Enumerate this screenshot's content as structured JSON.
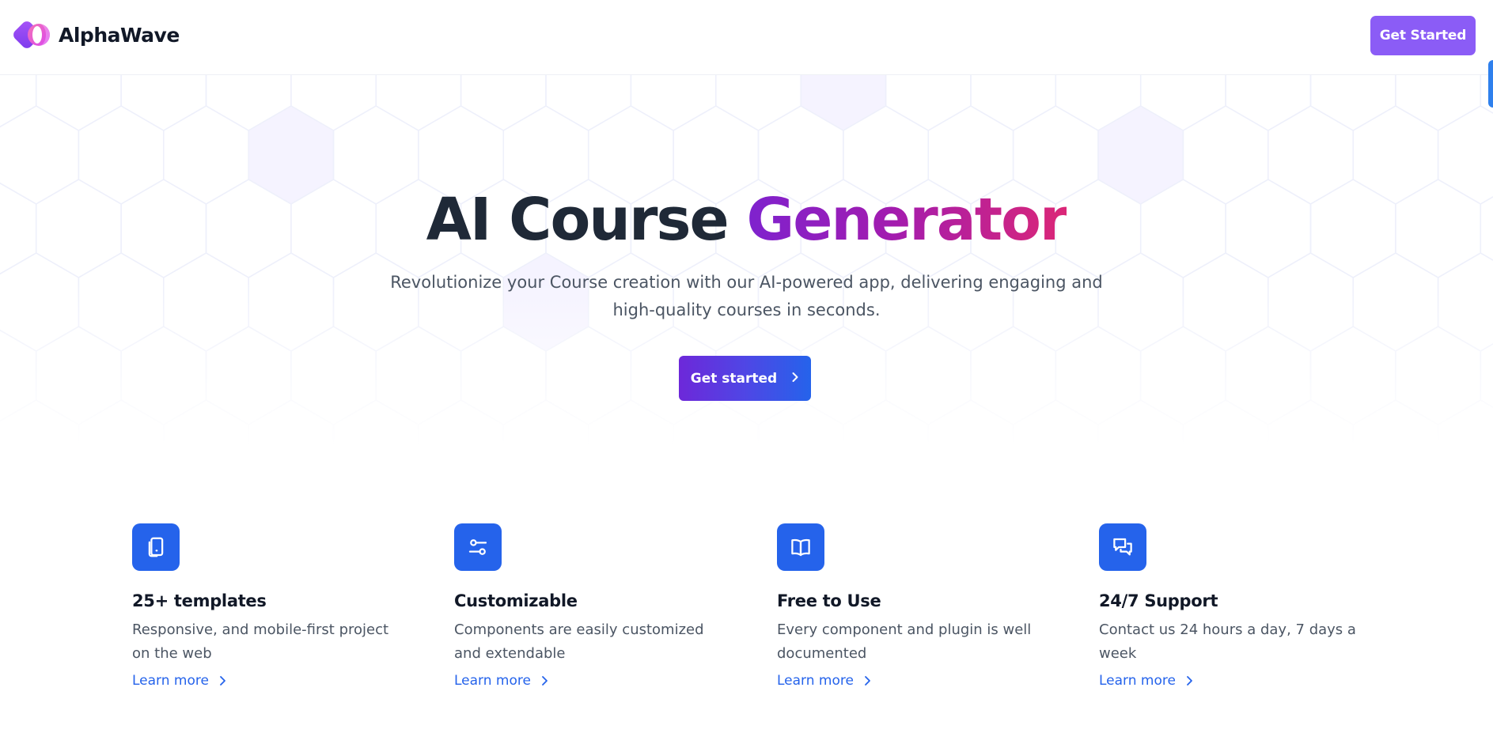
{
  "brand": {
    "name": "AlphaWave",
    "colors": {
      "primary": "#2563eb",
      "violet": "#8b5cf6",
      "magenta": "#db2777"
    }
  },
  "nav": {
    "cta_label": "Get Started"
  },
  "hero": {
    "title_plain": "AI Course",
    "title_accent": "Generator",
    "subtitle": "Revolutionize your Course creation with our AI-powered app, delivering engaging and high-quality courses in seconds.",
    "cta_label": "Get started",
    "cta_icon": "chevron-right-icon"
  },
  "features": [
    {
      "icon": "tablet-icon",
      "title": "25+ templates",
      "description": "Responsive, and mobile-first project on the web",
      "link_label": "Learn more"
    },
    {
      "icon": "sliders-icon",
      "title": "Customizable",
      "description": "Components are easily customized and extendable",
      "link_label": "Learn more"
    },
    {
      "icon": "book-open-icon",
      "title": "Free to Use",
      "description": "Every component and plugin is well documented",
      "link_label": "Learn more"
    },
    {
      "icon": "chat-bubbles-icon",
      "title": "24/7 Support",
      "description": "Contact us 24 hours a day, 7 days a week",
      "link_label": "Learn more"
    }
  ]
}
